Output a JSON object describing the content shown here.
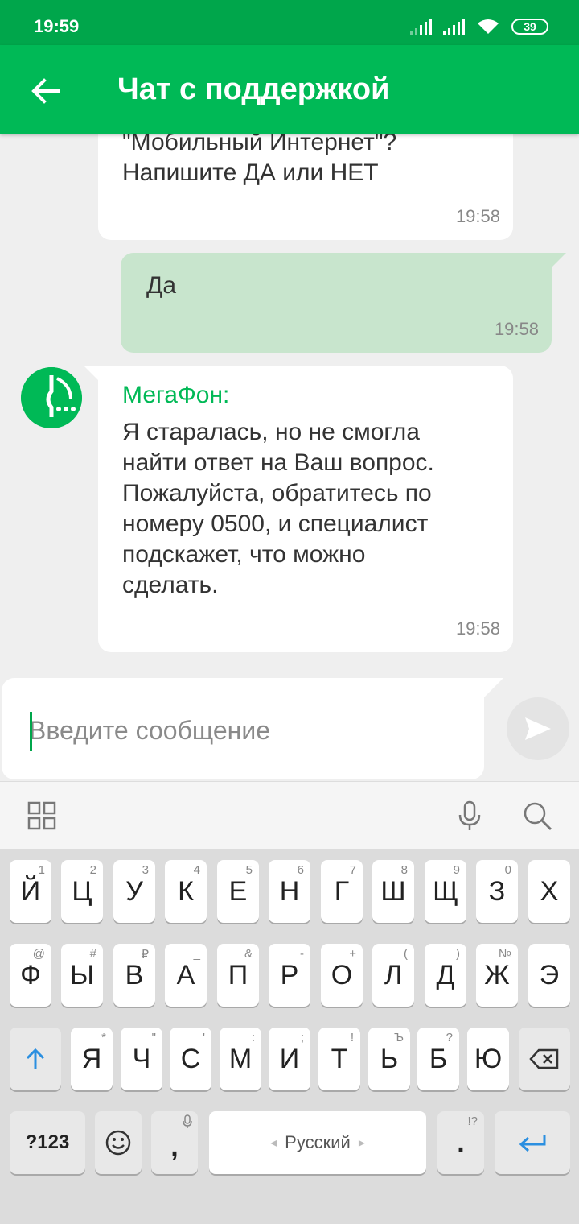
{
  "status": {
    "time": "19:59",
    "battery": "39"
  },
  "header": {
    "title": "Чат с поддержкой"
  },
  "messages": [
    {
      "text_lines": [
        "\"Мобильный Интернет\"?",
        "Напишите ДА или НЕТ"
      ],
      "time": "19:58"
    },
    {
      "text": "Да",
      "time": "19:58"
    },
    {
      "sender": "МегаФон:",
      "text_lines": [
        "Я старалась, но не смогла",
        "найти ответ на Ваш вопрос.",
        "Пожалуйста, обратитесь по",
        "номеру 0500, и специалист",
        "подскажет, что можно",
        "сделать."
      ],
      "time": "19:58"
    }
  ],
  "input": {
    "placeholder": "Введите сообщение"
  },
  "keyboard": {
    "row1": [
      {
        "k": "Й",
        "h": "1"
      },
      {
        "k": "Ц",
        "h": "2"
      },
      {
        "k": "У",
        "h": "3"
      },
      {
        "k": "К",
        "h": "4"
      },
      {
        "k": "Е",
        "h": "5"
      },
      {
        "k": "Н",
        "h": "6"
      },
      {
        "k": "Г",
        "h": "7"
      },
      {
        "k": "Ш",
        "h": "8"
      },
      {
        "k": "Щ",
        "h": "9"
      },
      {
        "k": "З",
        "h": "0"
      },
      {
        "k": "Х",
        "h": ""
      }
    ],
    "row2": [
      {
        "k": "Ф",
        "h": "@"
      },
      {
        "k": "Ы",
        "h": "#"
      },
      {
        "k": "В",
        "h": "₽"
      },
      {
        "k": "А",
        "h": "_"
      },
      {
        "k": "П",
        "h": "&"
      },
      {
        "k": "Р",
        "h": "-"
      },
      {
        "k": "О",
        "h": "+"
      },
      {
        "k": "Л",
        "h": "("
      },
      {
        "k": "Д",
        "h": ")"
      },
      {
        "k": "Ж",
        "h": "№"
      },
      {
        "k": "Э",
        "h": ""
      }
    ],
    "row3": [
      {
        "k": "Я",
        "h": "*"
      },
      {
        "k": "Ч",
        "h": "\""
      },
      {
        "k": "С",
        "h": "'"
      },
      {
        "k": "М",
        "h": ":"
      },
      {
        "k": "И",
        "h": ";"
      },
      {
        "k": "Т",
        "h": "!"
      },
      {
        "k": "Ь",
        "h": "Ъ"
      },
      {
        "k": "Б",
        "h": "?"
      },
      {
        "k": "Ю",
        "h": ""
      }
    ],
    "sym_label": "?123",
    "comma": ",",
    "space_label": "Русский",
    "period": ".",
    "period_hint": "!?"
  }
}
